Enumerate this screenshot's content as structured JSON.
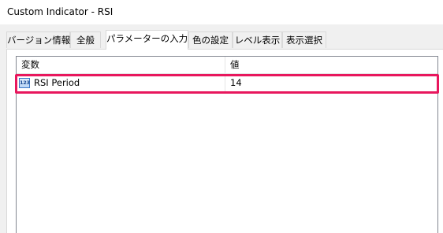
{
  "window": {
    "title": "Custom Indicator - RSI"
  },
  "tabs": [
    {
      "label": "バージョン情報",
      "active": false
    },
    {
      "label": "全般",
      "active": false
    },
    {
      "label": "パラメーターの入力",
      "active": true
    },
    {
      "label": "色の設定",
      "active": false
    },
    {
      "label": "レベル表示",
      "active": false
    },
    {
      "label": "表示選択",
      "active": false
    }
  ],
  "grid": {
    "columns": [
      "変数",
      "値"
    ],
    "rows": [
      {
        "icon": "integer-123-icon",
        "icon_text": "123",
        "variable": "RSI Period",
        "value": "14",
        "highlighted": true
      }
    ]
  },
  "colors": {
    "highlight": "#e8175d",
    "icon_blue": "#3a78c7"
  }
}
